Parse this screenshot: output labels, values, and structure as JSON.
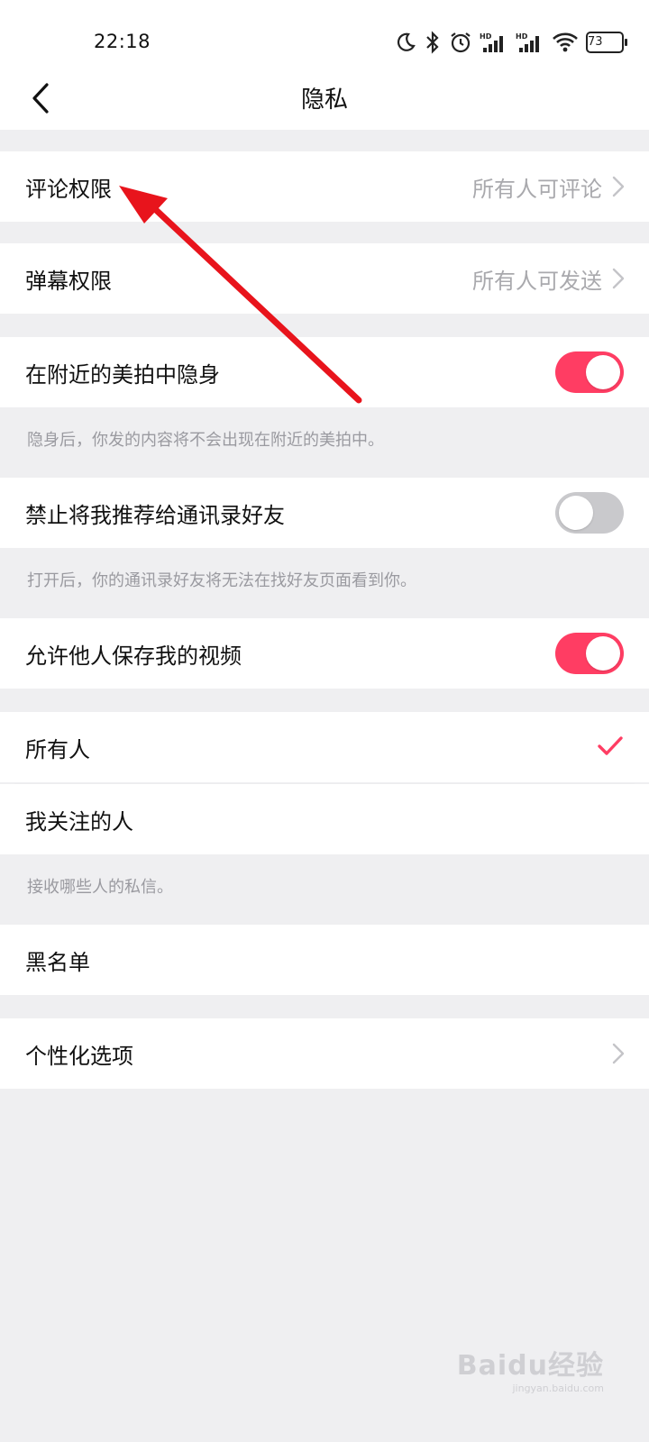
{
  "status_bar": {
    "time": "22:18",
    "icons": [
      "moon-icon",
      "bluetooth-icon",
      "alarm-icon",
      "signal-hd-icon",
      "signal-hd-icon",
      "wifi-icon"
    ],
    "battery": "73"
  },
  "header": {
    "title": "隐私",
    "back_icon": "chevron-left-icon"
  },
  "settings": {
    "comment_permission": {
      "label": "评论权限",
      "value": "所有人可评论"
    },
    "danmaku_permission": {
      "label": "弹幕权限",
      "value": "所有人可发送"
    },
    "hide_nearby": {
      "label": "在附近的美拍中隐身",
      "enabled": true,
      "hint": "隐身后，你发的内容将不会出现在附近的美拍中。"
    },
    "no_recommend_contacts": {
      "label": "禁止将我推荐给通讯录好友",
      "enabled": false,
      "hint": "打开后，你的通讯录好友将无法在找好友页面看到你。"
    },
    "allow_save_video": {
      "label": "允许他人保存我的视频",
      "enabled": true
    },
    "message_from": {
      "options": [
        "所有人",
        "我关注的人"
      ],
      "selected": "所有人",
      "hint": "接收哪些人的私信。"
    },
    "blacklist": {
      "label": "黑名单"
    },
    "personalization": {
      "label": "个性化选项"
    }
  },
  "colors": {
    "accent": "#ff3d63",
    "annotation_arrow": "#e8141c",
    "background": "#efeff1"
  },
  "watermark": {
    "text": "Baidu经验",
    "sub": "jingyan.baidu.com"
  }
}
